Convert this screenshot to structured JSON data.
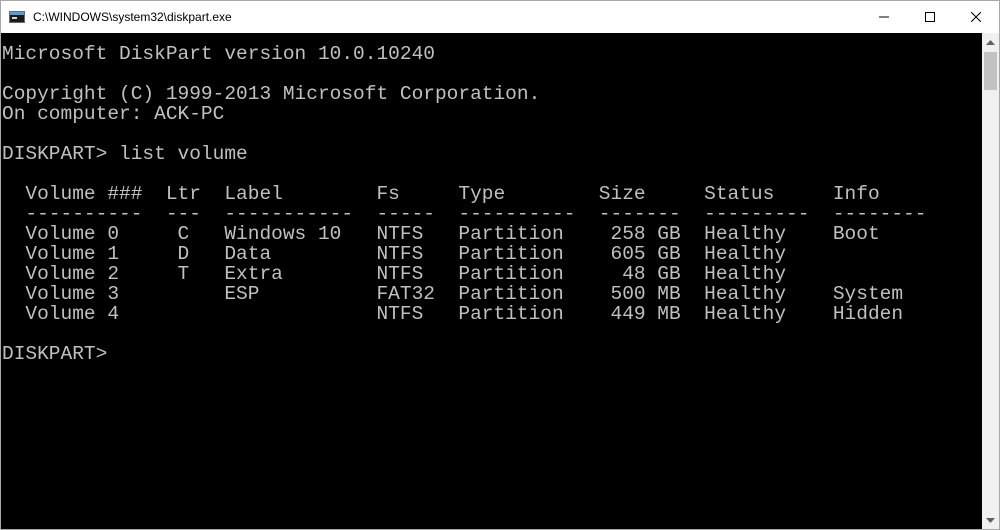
{
  "window": {
    "title": "C:\\WINDOWS\\system32\\diskpart.exe",
    "icon": "console-app-icon",
    "controls": [
      "minimize-icon",
      "maximize-icon",
      "close-icon"
    ]
  },
  "console": {
    "background": "#000000",
    "foreground": "#c0c0c0",
    "lines": [
      "Microsoft DiskPart version 10.0.10240",
      "",
      "Copyright (C) 1999-2013 Microsoft Corporation.",
      "On computer: ACK-PC",
      "",
      "DISKPART> list volume",
      "",
      "  Volume ###  Ltr  Label        Fs     Type        Size     Status     Info",
      "  ----------  ---  -----------  -----  ----------  -------  ---------  --------",
      "  Volume 0     C   Windows 10   NTFS   Partition    258 GB  Healthy    Boot",
      "  Volume 1     D   Data         NTFS   Partition    605 GB  Healthy",
      "  Volume 2     T   Extra        NTFS   Partition     48 GB  Healthy",
      "  Volume 3         ESP          FAT32  Partition    500 MB  Healthy    System",
      "  Volume 4                      NTFS   Partition    449 MB  Healthy    Hidden",
      "",
      "DISKPART> "
    ]
  },
  "scrollbar": {
    "up_icon": "scroll-up-arrow-icon",
    "down_icon": "scroll-down-arrow-icon"
  }
}
